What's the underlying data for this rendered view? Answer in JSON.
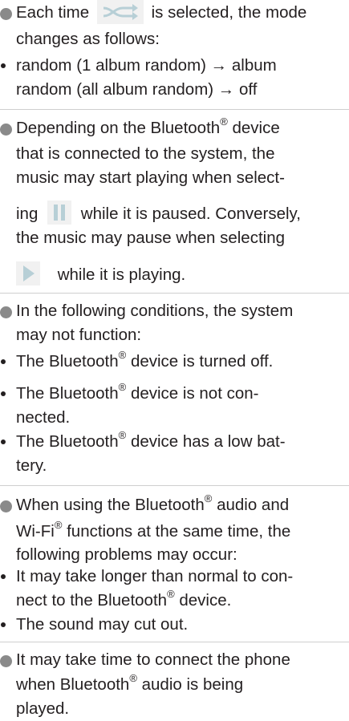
{
  "section1": {
    "l1_a": "Each time",
    "l1_b": "is selected, the mode",
    "l2": "changes as follows:",
    "b1_l1": "random (1 album random) → album",
    "b1_l2": "random (all album random) → off",
    "icon": "shuffle-icon"
  },
  "section2": {
    "l1_a": "Depending on the Bluetooth",
    "l1_sup": "®",
    "l1_b": " device",
    "l2": "that is connected to the system, the",
    "l3": "music may start playing when select-",
    "l4_a": "ing",
    "l4_b": "while it is paused. Conversely,",
    "l5": "the music may pause when selecting",
    "l6": "while it is playing.",
    "pause_icon": "pause-icon",
    "play_icon": "play-icon"
  },
  "section3": {
    "l1": "In the following conditions, the system",
    "l2": "may not function:",
    "b1_a": "The Bluetooth",
    "b1_sup": "®",
    "b1_b": " device is turned off.",
    "b2_a": "The Bluetooth",
    "b2_sup": "®",
    "b2_b": " device is not con-",
    "b2_l2": "nected.",
    "b3_a": "The Bluetooth",
    "b3_sup": "®",
    "b3_b": " device has a low bat-",
    "b3_l2": "tery."
  },
  "section4": {
    "l1_a": "When using the Bluetooth",
    "l1_sup": "®",
    "l1_b": " audio and",
    "l2_a": "Wi-Fi",
    "l2_sup": "®",
    "l2_b": " functions at the same time, the",
    "l3": "following problems may occur:",
    "b1_l1": "It may take longer than normal to con-",
    "b1_l2_a": "nect to the Bluetooth",
    "b1_l2_sup": "®",
    "b1_l2_b": " device.",
    "b2": "The sound may cut out."
  },
  "section5": {
    "l1": "It may take time to connect the phone",
    "l2_a": "when Bluetooth",
    "l2_sup": "®",
    "l2_b": " audio is being",
    "l3": "played."
  },
  "colors": {
    "text": "#231f20",
    "dot": "#8a8a8a",
    "icon_bg": "#e8e8e8",
    "icon_fg": "#b7cfd6",
    "divider": "#cfcfcf"
  }
}
